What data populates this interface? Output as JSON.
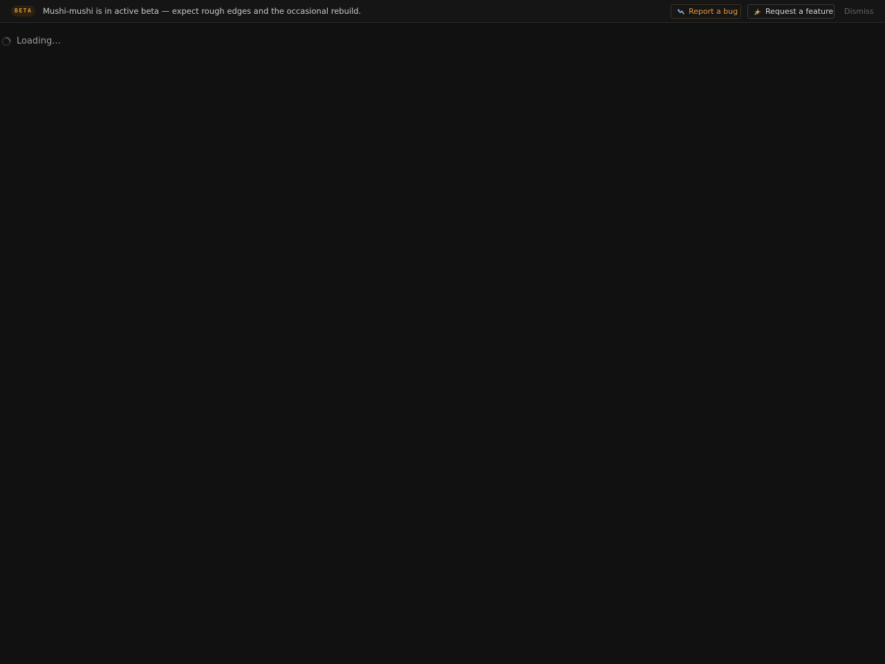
{
  "banner": {
    "badge": "BETA",
    "message": "Mushi-mushi is in active beta — expect rough edges and the occasional rebuild.",
    "report_bug_label": "Report a bug",
    "report_bug_icon": "bug-icon",
    "request_feature_label": "Request a feature",
    "request_feature_icon": "sparkle-icon",
    "dismiss_label": "Dismiss",
    "accent_color": "#e89a3c"
  },
  "main": {
    "loading_text": "Loading...",
    "loading_icon": "spinner-icon"
  }
}
